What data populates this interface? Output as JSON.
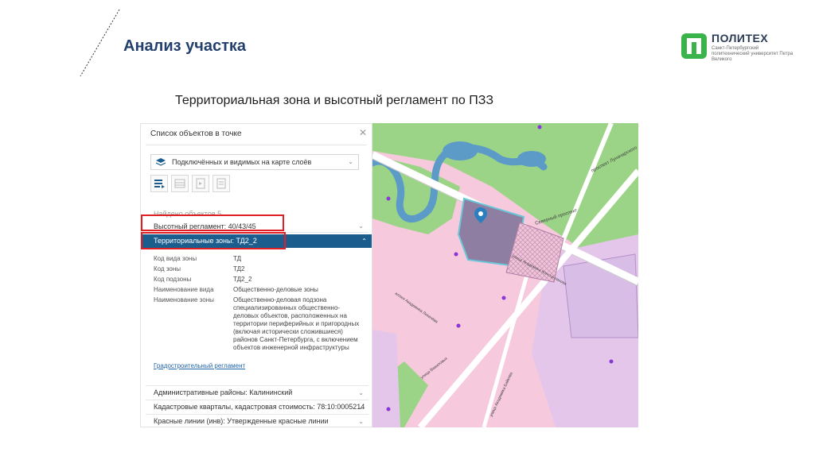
{
  "slide": {
    "title": "Анализ участка",
    "subtitle": "Территориальная зона и высотный регламент по ПЗЗ"
  },
  "logo": {
    "name": "ПОЛИТЕХ",
    "tagline": "Санкт-Петербургский политехнический университет Петра Великого"
  },
  "panel": {
    "header": "Список объектов в точке",
    "layer_select": "Подключённых и видимых на карте слоёв",
    "found_count": "Найдено объектов 5",
    "height_regulation": "Высотный регламент: 40/43/45",
    "territorial_zones": "Территориальные зоны: ТД2_2",
    "attributes": [
      {
        "key": "Код вида зоны",
        "value": "ТД"
      },
      {
        "key": "Код зоны",
        "value": "ТД2"
      },
      {
        "key": "Код подзоны",
        "value": "ТД2_2"
      },
      {
        "key": "Наименование вида",
        "value": "Общественно-деловые зоны"
      },
      {
        "key": "Наименование зоны",
        "value": "Общественно-деловая подзона специализированных общественно-деловых объектов, расположенных на территории периферийных и пригородных (включая исторически сложившиеся) районов Санкт-Петербурга, с включением объектов инженерной инфраструктуры"
      }
    ],
    "link": "Градостроительный регламент",
    "accordions": [
      "Административные районы: Калининский",
      "Кадастровые кварталы, кадастровая стоимость: 78:10:0005214",
      "Красные линии (инв): Утвержденные красные линии"
    ]
  },
  "map": {
    "labels": {
      "prospect_top": "проспект Луначарского",
      "prospect_mid": "Северный проспект",
      "street_konstantinova": "улица Академика Константинова",
      "alley": "аллея Академика Лихачёва",
      "street_vavilovykh": "улица Вавиловых",
      "street_bottom": "улица Академика Байкова"
    },
    "colors": {
      "public_zone": "#f6c9dd",
      "green_zone": "#9bd486",
      "water": "#5c9ac8",
      "selected_parcel": "#8e7fa2",
      "road": "#ffffff"
    }
  }
}
